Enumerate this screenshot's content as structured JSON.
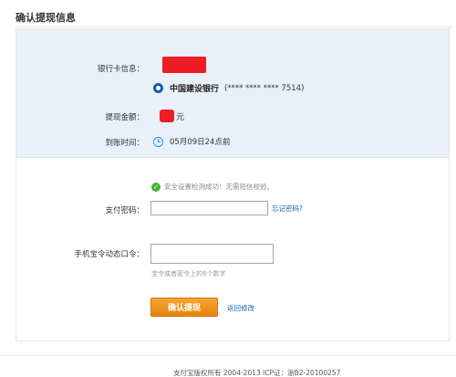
{
  "page": {
    "title": "确认提现信息"
  },
  "info": {
    "bank_card_label": "银行卡信息：",
    "bank_name": "中国建设银行",
    "card_mask": "(**** **** **** 7514)",
    "amount_label": "提现金额：",
    "amount_unit": "元",
    "arrival_label": "到账时间：",
    "arrival_value": "05月09日24点前"
  },
  "security": {
    "success_text": "安全设置检测成功！无需短信校验。"
  },
  "form": {
    "password_label": "支付密码：",
    "password_value": "",
    "forgot_link": "忘记密码?",
    "token_label": "手机宝令动态口令：",
    "token_value": "",
    "token_hint": "宝令或者密令上的6个数字",
    "confirm_button": "确认提现",
    "back_link": "返回修改"
  },
  "footer": {
    "text": "支付宝版权所有 2004-2013 ICP证：浙B2-20100257"
  },
  "colors": {
    "info_bg": "#e9f0f8",
    "button_orange": "#f29a23",
    "link_blue": "#1a62b5",
    "redaction_red": "#ee1c24",
    "success_green": "#4caf34"
  },
  "icons": [
    "ccb-bank-logo-icon",
    "clock-icon",
    "checkmark-icon"
  ]
}
